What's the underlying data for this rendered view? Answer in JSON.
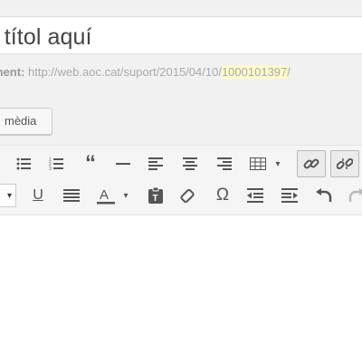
{
  "post": {
    "title": "l títol aquí",
    "permalink_label": "ment:",
    "permalink_base": "http://web.aoc.cat/suport/2015/04/10/",
    "permalink_slug": "1000101397",
    "permalink_tail": "/"
  },
  "media": {
    "button_label": "mèdia"
  },
  "toolbar": {
    "row1": [
      {
        "name": "bulleted-list-icon",
        "glyph": "☰"
      },
      {
        "name": "numbered-list-icon",
        "glyph": "≣"
      },
      {
        "name": "blockquote-icon",
        "glyph": "❝"
      },
      {
        "name": "horizontal-line-icon",
        "glyph": "—"
      },
      {
        "name": "align-left-icon",
        "glyph": "≡"
      },
      {
        "name": "align-center-icon",
        "glyph": "≡"
      },
      {
        "name": "align-right-icon",
        "glyph": "≡"
      },
      {
        "name": "table-icon",
        "glyph": "▦"
      },
      {
        "name": "insert-link-icon",
        "glyph": "🔗"
      },
      {
        "name": "remove-link-icon",
        "glyph": "⛓"
      }
    ],
    "row2": [
      {
        "name": "underline-icon",
        "glyph": "U"
      },
      {
        "name": "justify-icon",
        "glyph": "≡"
      },
      {
        "name": "text-color-icon",
        "glyph": "A"
      },
      {
        "name": "paste-text-icon",
        "glyph": "📋"
      },
      {
        "name": "clear-formatting-icon",
        "glyph": "◇"
      },
      {
        "name": "special-character-icon",
        "glyph": "Ω"
      },
      {
        "name": "outdent-icon",
        "glyph": "⇤"
      },
      {
        "name": "indent-icon",
        "glyph": "⇥"
      },
      {
        "name": "undo-icon",
        "glyph": "↶"
      },
      {
        "name": "redo-icon",
        "glyph": "↷"
      }
    ],
    "dropdown_caret": "▾"
  }
}
